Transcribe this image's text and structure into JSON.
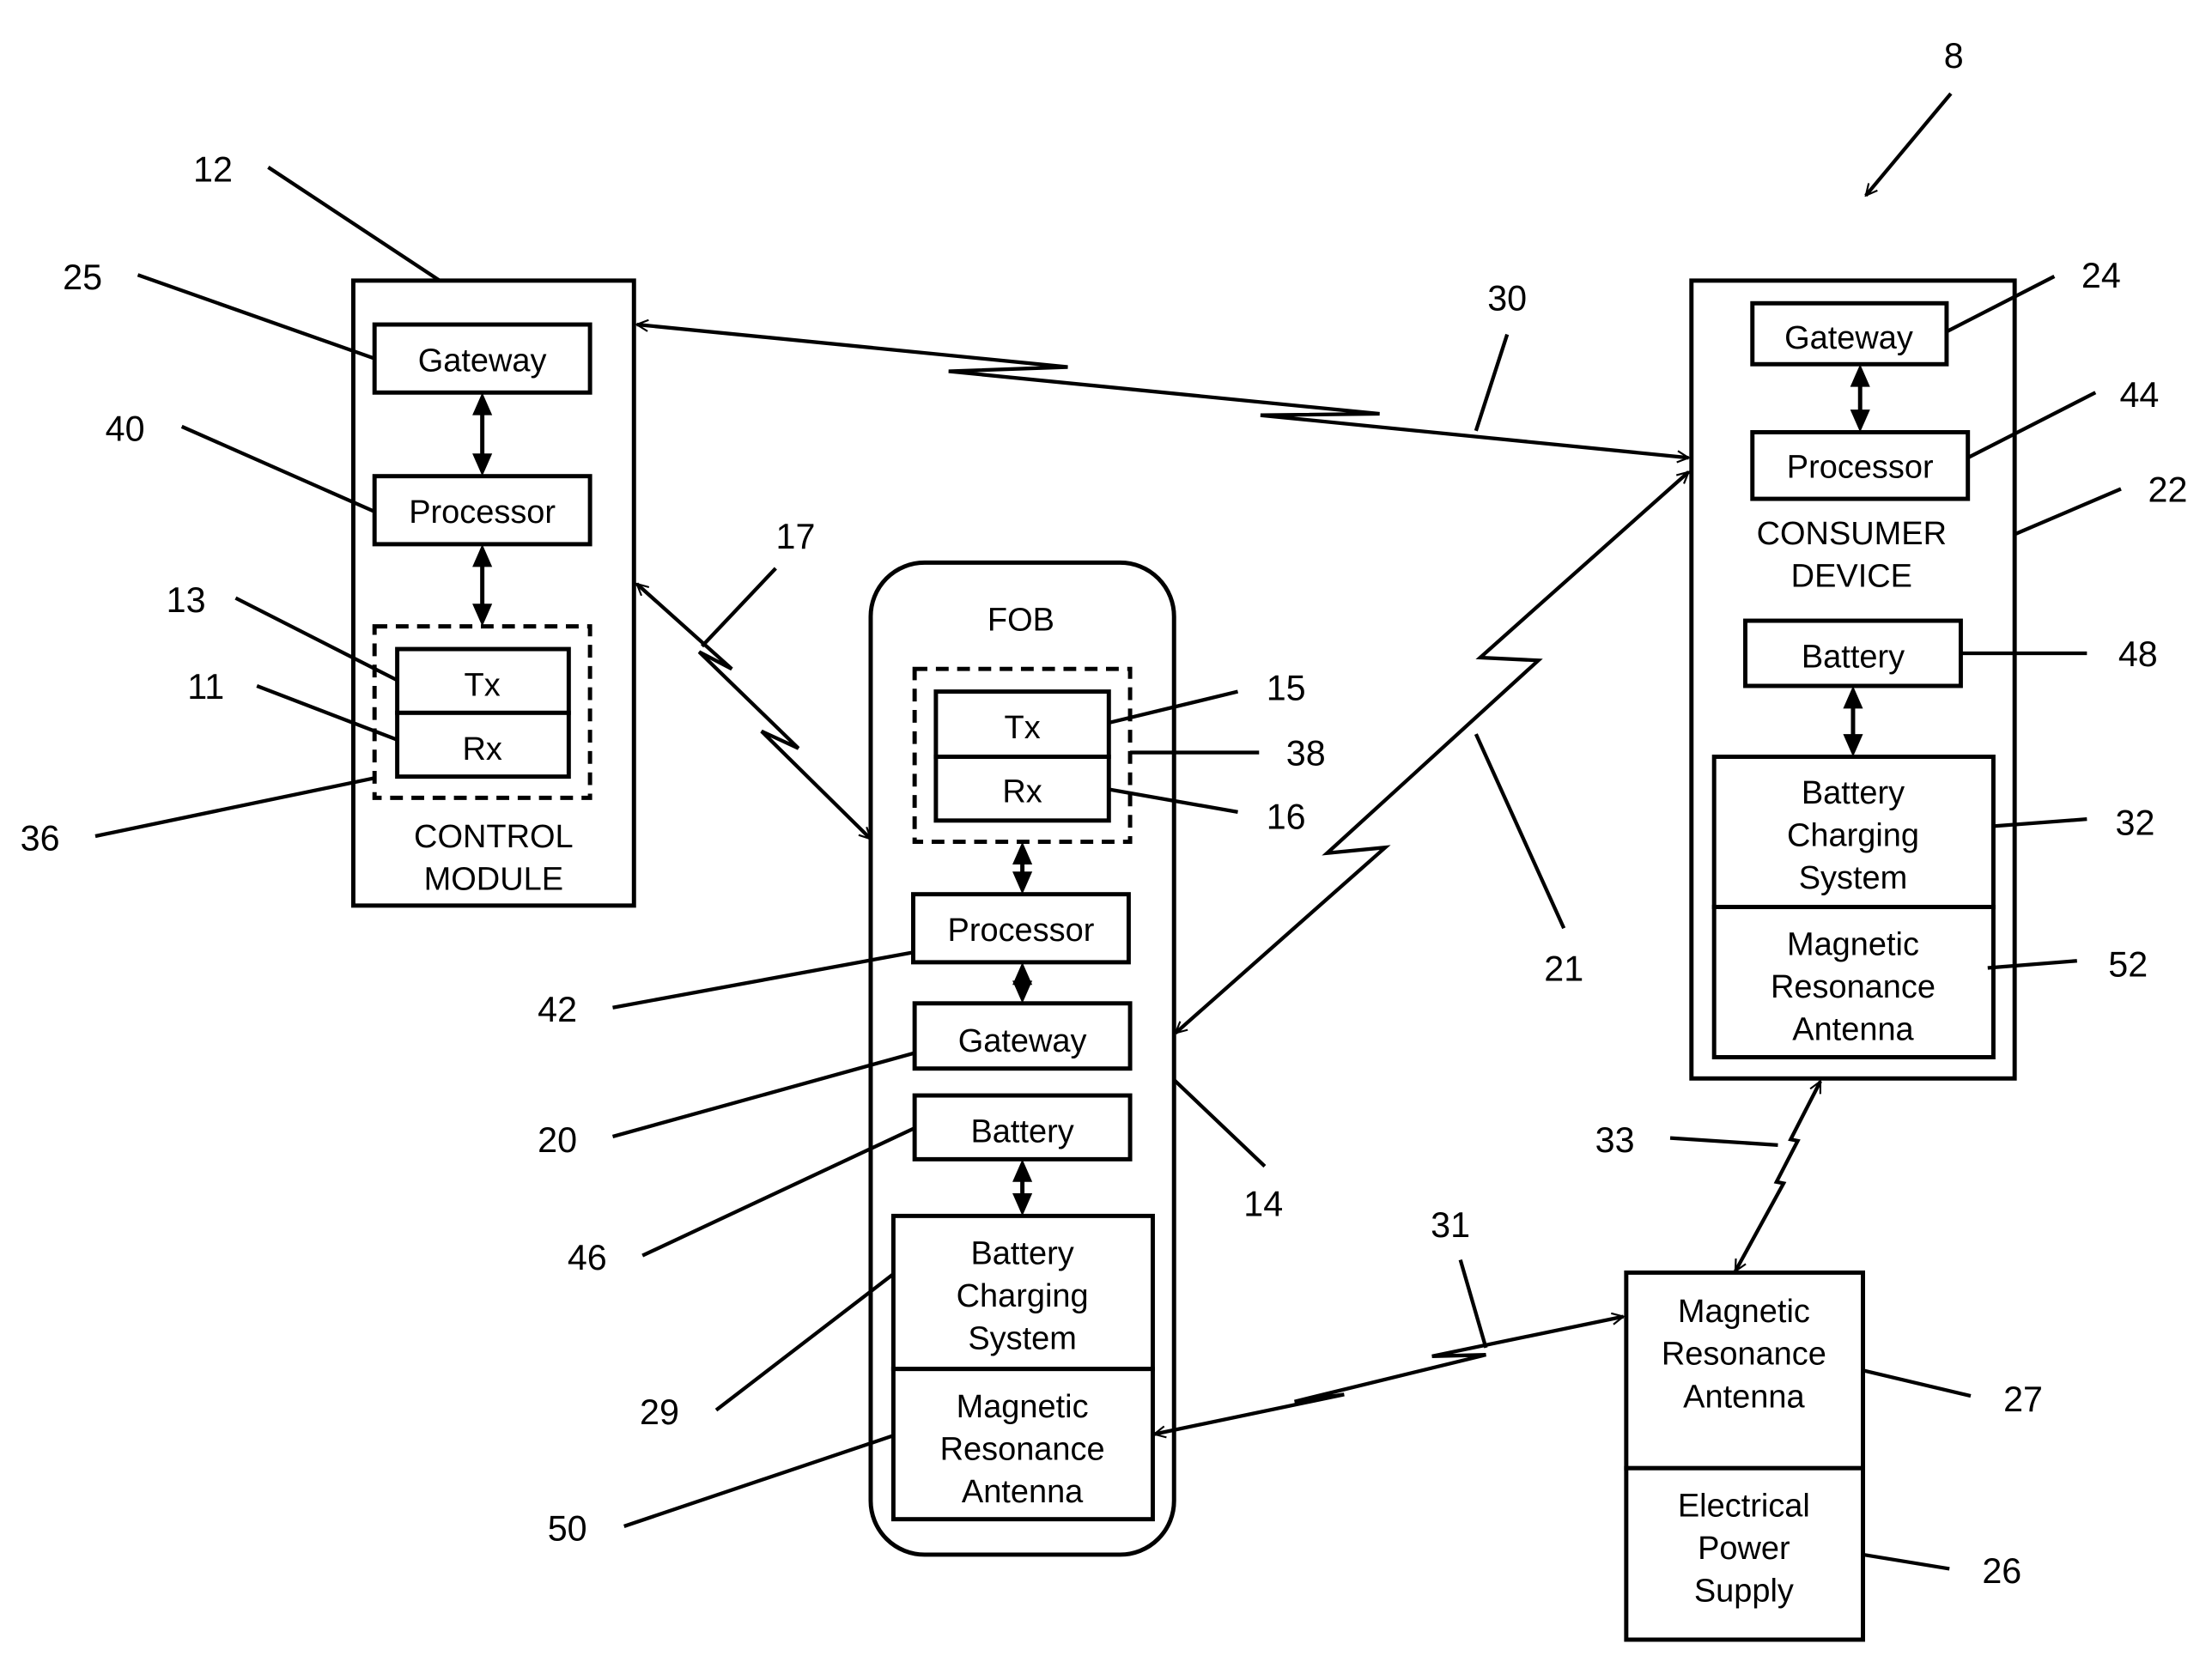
{
  "figure": {
    "system_ref": "8",
    "control_module": {
      "ref": "12",
      "title_line1": "CONTROL",
      "title_line2": "MODULE",
      "gateway": {
        "label": "Gateway",
        "ref": "25"
      },
      "processor": {
        "label": "Processor",
        "ref": "40"
      },
      "transceiver": {
        "ref": "36",
        "tx_label": "Tx",
        "tx_ref": "13",
        "rx_label": "Rx",
        "rx_ref": "11"
      }
    },
    "fob": {
      "ref": "14",
      "title": "FOB",
      "transceiver": {
        "ref": "38",
        "tx_label": "Tx",
        "tx_ref": "15",
        "rx_label": "Rx",
        "rx_ref": "16"
      },
      "processor": {
        "label": "Processor",
        "ref": "42"
      },
      "gateway": {
        "label": "Gateway",
        "ref": "20"
      },
      "battery": {
        "label": "Battery",
        "ref": "46"
      },
      "charging": {
        "line1": "Battery",
        "line2": "Charging",
        "line3": "System",
        "ref": "29"
      },
      "antenna": {
        "line1": "Magnetic",
        "line2": "Resonance",
        "line3": "Antenna",
        "ref": "50"
      }
    },
    "consumer_device": {
      "ref": "22",
      "title_line1": "CONSUMER",
      "title_line2": "DEVICE",
      "gateway": {
        "label": "Gateway",
        "ref": "24"
      },
      "processor": {
        "label": "Processor",
        "ref": "44"
      },
      "battery": {
        "label": "Battery",
        "ref": "48"
      },
      "charging": {
        "line1": "Battery",
        "line2": "Charging",
        "line3": "System",
        "ref": "32"
      },
      "antenna": {
        "line1": "Magnetic",
        "line2": "Resonance",
        "line3": "Antenna",
        "ref": "52"
      }
    },
    "charger": {
      "antenna": {
        "line1": "Magnetic",
        "line2": "Resonance",
        "line3": "Antenna",
        "ref": "27"
      },
      "power_supply": {
        "line1": "Electrical",
        "line2": "Power",
        "line3": "Supply",
        "ref": "26"
      }
    },
    "links": {
      "control_to_consumer": "30",
      "control_to_fob": "17",
      "fob_to_consumer": "21",
      "fob_to_charger": "31",
      "charger_to_consumer": "33"
    }
  }
}
